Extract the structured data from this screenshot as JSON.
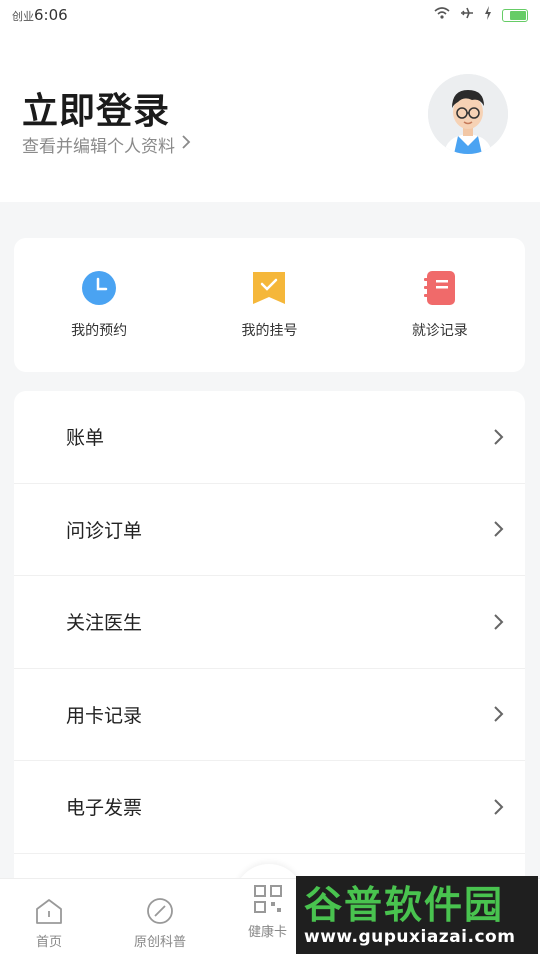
{
  "status_bar": {
    "time_prefix": "创业",
    "time": "6:06",
    "signal_text": ""
  },
  "header": {
    "title": "立即登录",
    "subtitle": "查看并编辑个人资料"
  },
  "quick_actions": [
    {
      "label": "我的预约",
      "icon": "clock-icon",
      "color": "#4aa3f2"
    },
    {
      "label": "我的挂号",
      "icon": "bookmark-check-icon",
      "color": "#f5b73a"
    },
    {
      "label": "就诊记录",
      "icon": "notebook-icon",
      "color": "#f06a6a"
    }
  ],
  "menu": [
    {
      "label": "账单"
    },
    {
      "label": "问诊订单"
    },
    {
      "label": "关注医生"
    },
    {
      "label": "用卡记录"
    },
    {
      "label": "电子发票"
    }
  ],
  "tabbar": {
    "home": "首页",
    "science": "原创科普",
    "health_card": "健康卡"
  },
  "watermark": {
    "title": "谷普软件园",
    "url": "www.gupuxiazai.com"
  }
}
